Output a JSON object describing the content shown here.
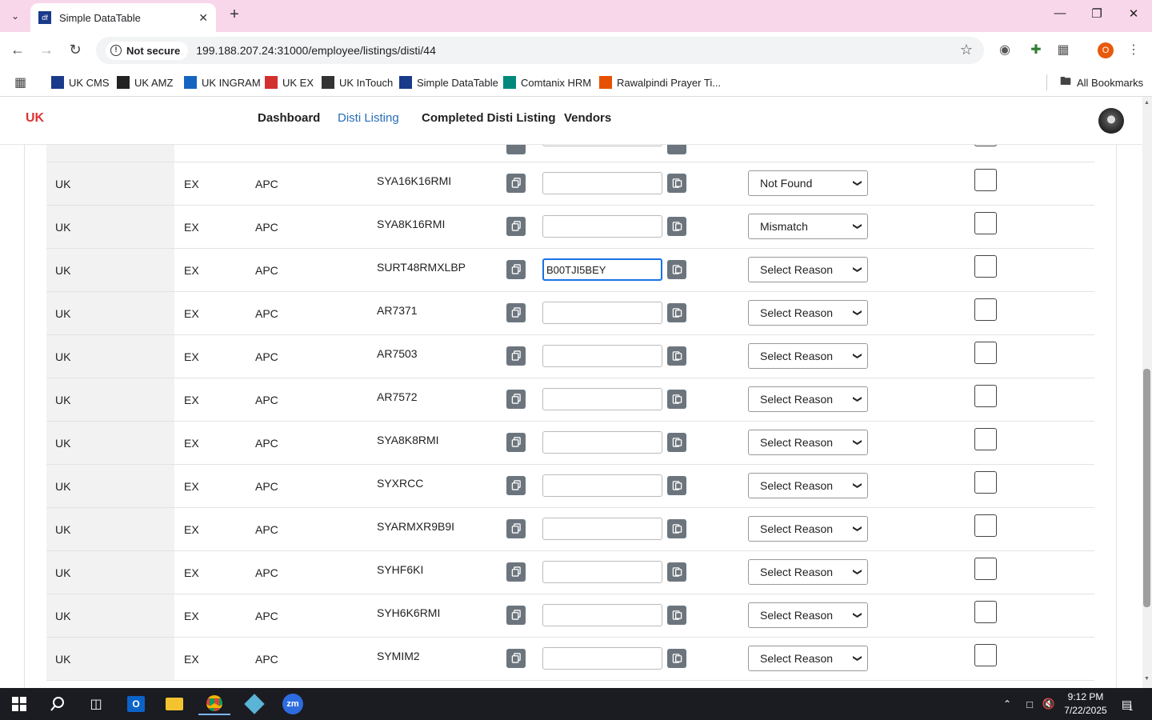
{
  "browser": {
    "tab_title": "Simple DataTable",
    "tab_favicon": "df",
    "security_label": "Not secure",
    "url": "199.188.207.24:31000/employee/listings/disti/44",
    "profile_initial": "O"
  },
  "bookmarks": [
    {
      "label": "UK CMS",
      "icon": "df-logo-icon",
      "color": "#1a3a8a"
    },
    {
      "label": "UK AMZ",
      "icon": "amazon-icon",
      "color": "#222222"
    },
    {
      "label": "UK INGRAM",
      "icon": "ingram-icon",
      "color": "#1565c0"
    },
    {
      "label": "UK EX",
      "icon": "ex-icon",
      "color": "#d32f2f"
    },
    {
      "label": "UK InTouch",
      "icon": "globe-icon",
      "color": "#333333"
    },
    {
      "label": "Simple DataTable",
      "icon": "df-logo-icon",
      "color": "#1a3a8a"
    },
    {
      "label": "Comtanix HRM",
      "icon": "comtanix-icon",
      "color": "#00897b"
    },
    {
      "label": "Rawalpindi Prayer Ti...",
      "icon": "prayer-icon",
      "color": "#e65100"
    }
  ],
  "all_bookmarks": "All Bookmarks",
  "app_nav": {
    "logo_text": "UK",
    "links": [
      "Dashboard",
      "Disti Listing",
      "Completed Disti Listing",
      "Vendors"
    ],
    "active_index": 1
  },
  "rows": [
    {
      "country": "UK",
      "source": "EX",
      "vendor": "APC",
      "sku": "SYA16K16RMI",
      "asin": "",
      "reason": "Not Found"
    },
    {
      "country": "UK",
      "source": "EX",
      "vendor": "APC",
      "sku": "SYA8K16RMI",
      "asin": "",
      "reason": "Mismatch"
    },
    {
      "country": "UK",
      "source": "EX",
      "vendor": "APC",
      "sku": "SURT48RMXLBP",
      "asin": "B00TJI5BEY",
      "reason": "Select Reason"
    },
    {
      "country": "UK",
      "source": "EX",
      "vendor": "APC",
      "sku": "AR7371",
      "asin": "",
      "reason": "Select Reason"
    },
    {
      "country": "UK",
      "source": "EX",
      "vendor": "APC",
      "sku": "AR7503",
      "asin": "",
      "reason": "Select Reason"
    },
    {
      "country": "UK",
      "source": "EX",
      "vendor": "APC",
      "sku": "AR7572",
      "asin": "",
      "reason": "Select Reason"
    },
    {
      "country": "UK",
      "source": "EX",
      "vendor": "APC",
      "sku": "SYA8K8RMI",
      "asin": "",
      "reason": "Select Reason"
    },
    {
      "country": "UK",
      "source": "EX",
      "vendor": "APC",
      "sku": "SYXRCC",
      "asin": "",
      "reason": "Select Reason"
    },
    {
      "country": "UK",
      "source": "EX",
      "vendor": "APC",
      "sku": "SYARMXR9B9I",
      "asin": "",
      "reason": "Select Reason"
    },
    {
      "country": "UK",
      "source": "EX",
      "vendor": "APC",
      "sku": "SYHF6KI",
      "asin": "",
      "reason": "Select Reason"
    },
    {
      "country": "UK",
      "source": "EX",
      "vendor": "APC",
      "sku": "SYH6K6RMI",
      "asin": "",
      "reason": "Select Reason"
    },
    {
      "country": "UK",
      "source": "EX",
      "vendor": "APC",
      "sku": "SYMIM2",
      "asin": "",
      "reason": "Select Reason"
    }
  ],
  "focused_row": 2,
  "taskbar": {
    "time": "9:12 PM",
    "date": "7/22/2025",
    "notification_count": "1"
  }
}
